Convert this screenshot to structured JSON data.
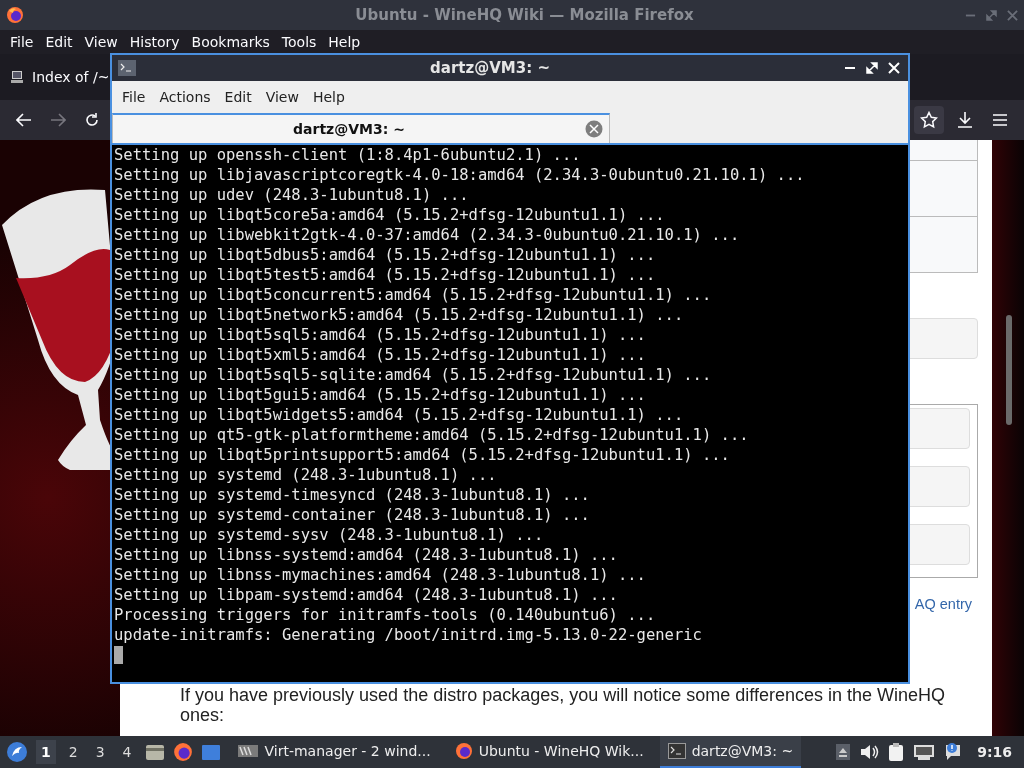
{
  "firefox": {
    "title": "Ubuntu - WineHQ Wiki — Mozilla Firefox",
    "menu": [
      "File",
      "Edit",
      "View",
      "History",
      "Bookmarks",
      "Tools",
      "Help"
    ],
    "tab": {
      "label": "Index of /~"
    },
    "page": {
      "link": "AQ entry",
      "paragraph": "If you have previously used the distro packages, you will notice some differences in the WineHQ ones:"
    }
  },
  "terminal": {
    "title": "dartz@VM3: ~",
    "menu": [
      "File",
      "Actions",
      "Edit",
      "View",
      "Help"
    ],
    "tab": {
      "label": "dartz@VM3: ~"
    },
    "lines": [
      "Setting up openssh-client (1:8.4p1-6ubuntu2.1) ...",
      "Setting up libjavascriptcoregtk-4.0-18:amd64 (2.34.3-0ubuntu0.21.10.1) ...",
      "Setting up udev (248.3-1ubuntu8.1) ...",
      "Setting up libqt5core5a:amd64 (5.15.2+dfsg-12ubuntu1.1) ...",
      "Setting up libwebkit2gtk-4.0-37:amd64 (2.34.3-0ubuntu0.21.10.1) ...",
      "Setting up libqt5dbus5:amd64 (5.15.2+dfsg-12ubuntu1.1) ...",
      "Setting up libqt5test5:amd64 (5.15.2+dfsg-12ubuntu1.1) ...",
      "Setting up libqt5concurrent5:amd64 (5.15.2+dfsg-12ubuntu1.1) ...",
      "Setting up libqt5network5:amd64 (5.15.2+dfsg-12ubuntu1.1) ...",
      "Setting up libqt5sql5:amd64 (5.15.2+dfsg-12ubuntu1.1) ...",
      "Setting up libqt5xml5:amd64 (5.15.2+dfsg-12ubuntu1.1) ...",
      "Setting up libqt5sql5-sqlite:amd64 (5.15.2+dfsg-12ubuntu1.1) ...",
      "Setting up libqt5gui5:amd64 (5.15.2+dfsg-12ubuntu1.1) ...",
      "Setting up libqt5widgets5:amd64 (5.15.2+dfsg-12ubuntu1.1) ...",
      "Setting up qt5-gtk-platformtheme:amd64 (5.15.2+dfsg-12ubuntu1.1) ...",
      "Setting up libqt5printsupport5:amd64 (5.15.2+dfsg-12ubuntu1.1) ...",
      "Setting up systemd (248.3-1ubuntu8.1) ...",
      "Setting up systemd-timesyncd (248.3-1ubuntu8.1) ...",
      "Setting up systemd-container (248.3-1ubuntu8.1) ...",
      "Setting up systemd-sysv (248.3-1ubuntu8.1) ...",
      "Setting up libnss-systemd:amd64 (248.3-1ubuntu8.1) ...",
      "Setting up libnss-mymachines:amd64 (248.3-1ubuntu8.1) ...",
      "Setting up libpam-systemd:amd64 (248.3-1ubuntu8.1) ...",
      "Processing triggers for initramfs-tools (0.140ubuntu6) ...",
      "update-initramfs: Generating /boot/initrd.img-5.13.0-22-generic"
    ]
  },
  "taskbar": {
    "workspaces": [
      {
        "label": "1",
        "selected": true
      },
      {
        "label": "2",
        "selected": false
      },
      {
        "label": "3",
        "selected": false
      },
      {
        "label": "4",
        "selected": false
      }
    ],
    "tasks": [
      {
        "label": "Virt-manager - 2 wind...",
        "kind": "vm",
        "selected": false
      },
      {
        "label": "Ubuntu - WineHQ Wik...",
        "kind": "browser",
        "selected": false
      },
      {
        "label": "dartz@VM3: ~",
        "kind": "terminal",
        "selected": true
      }
    ],
    "clock": "9:16"
  }
}
